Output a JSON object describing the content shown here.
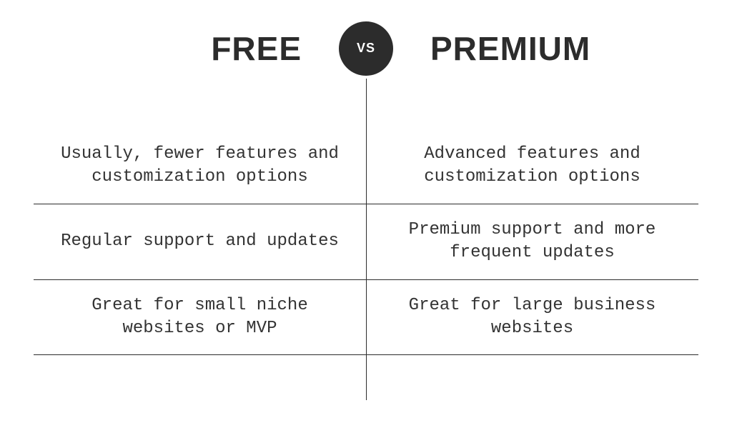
{
  "header": {
    "left_title": "FREE",
    "badge": "VS",
    "right_title": "PREMIUM"
  },
  "rows": [
    {
      "left": "Usually, fewer features and customization options",
      "right": "Advanced features and customization options"
    },
    {
      "left": "Regular support and updates",
      "right": "Premium support and more frequent updates"
    },
    {
      "left": "Great for small niche websites or MVP",
      "right": "Great for large business websites"
    }
  ]
}
